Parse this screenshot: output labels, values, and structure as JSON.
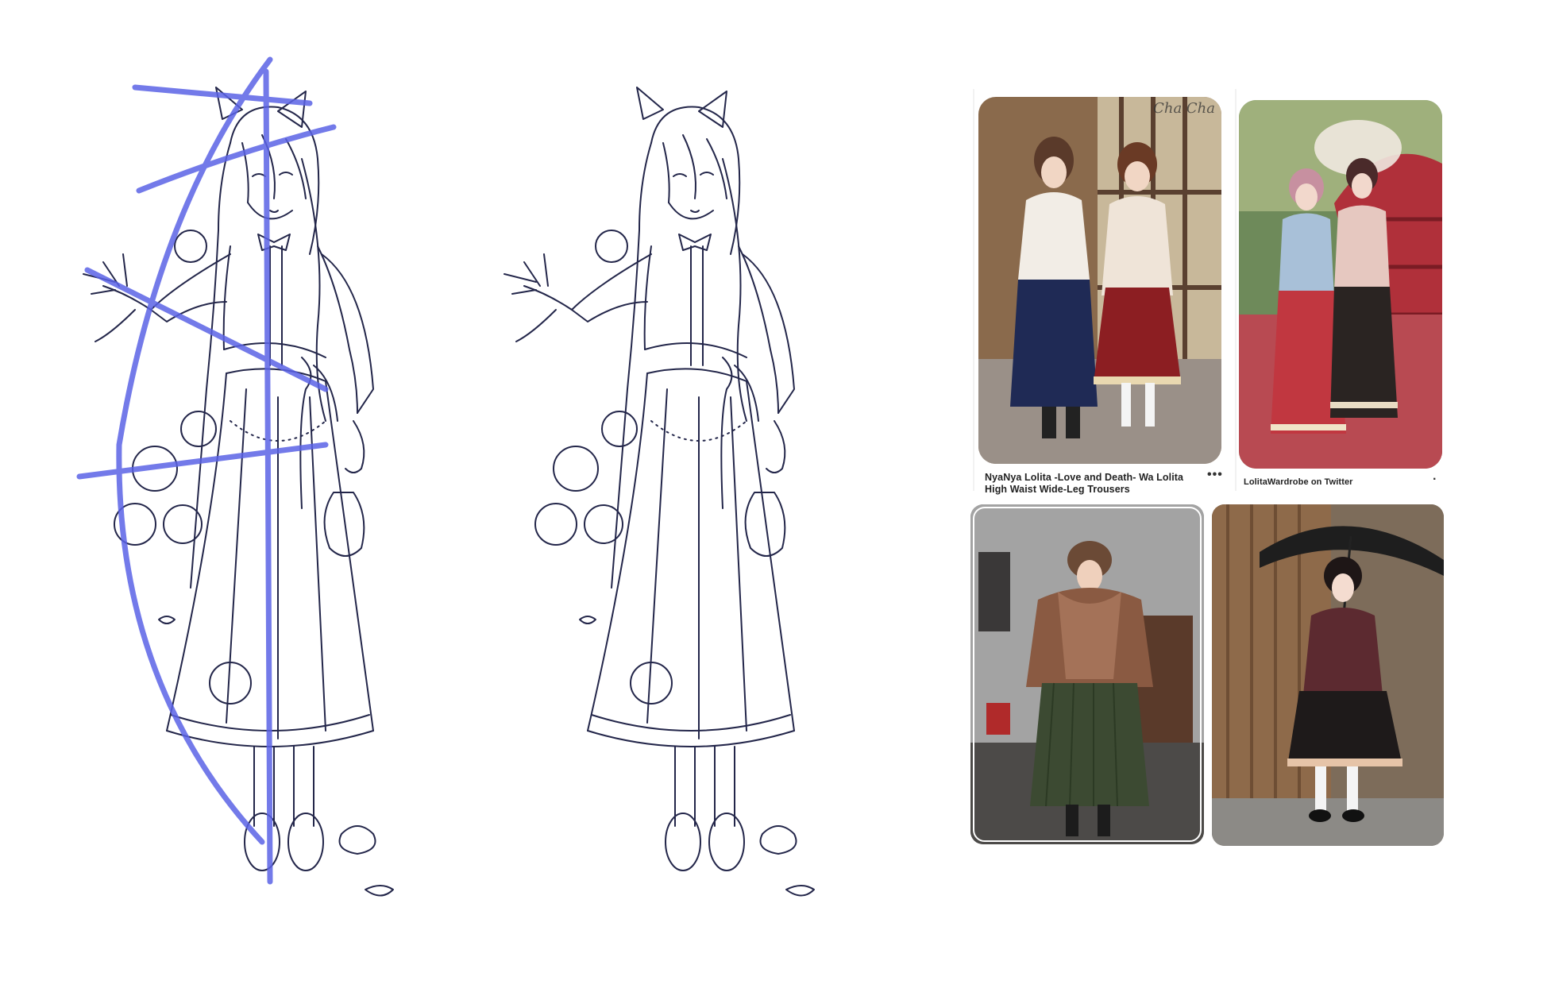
{
  "reference_board": {
    "pins": [
      {
        "caption_line1": "NyaNya Lolita -Love and Death- Wa Lolita",
        "caption_line2": "High Waist Wide-Leg Trousers",
        "more": "•••",
        "watermark": "Cha Cha"
      },
      {
        "caption": "LolitaWardrobe on Twitter",
        "more": "·"
      },
      {},
      {}
    ]
  },
  "colors": {
    "line_art": "#23264a",
    "guide_lines": "#5b63e6"
  }
}
